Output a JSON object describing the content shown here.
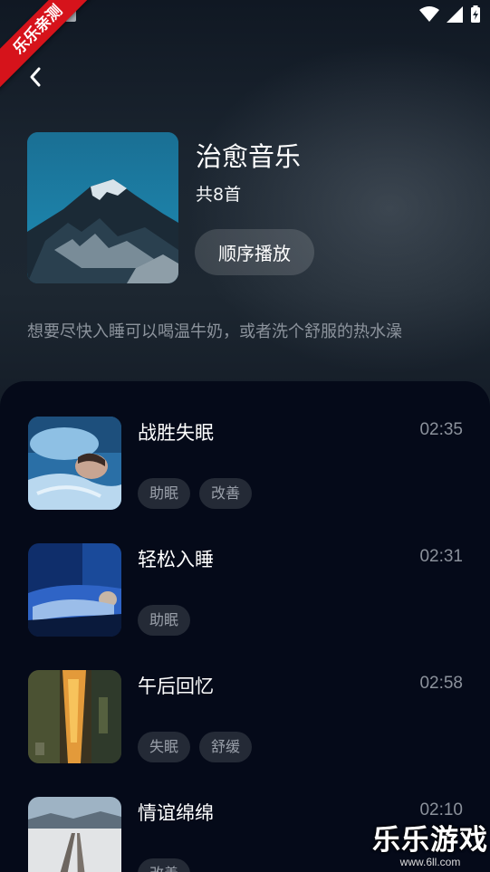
{
  "status_bar": {
    "icons": [
      "wifi-icon",
      "signal-icon",
      "battery-icon"
    ]
  },
  "ribbon": {
    "text": "乐乐亲测"
  },
  "album": {
    "title": "治愈音乐",
    "count": "共8首",
    "play_label": "顺序播放",
    "description": "想要尽快入睡可以喝温牛奶，或者洗个舒服的热水澡"
  },
  "songs": [
    {
      "title": "战胜失眠",
      "duration": "02:35",
      "tags": [
        "助眠",
        "改善"
      ]
    },
    {
      "title": "轻松入睡",
      "duration": "02:31",
      "tags": [
        "助眠"
      ]
    },
    {
      "title": "午后回忆",
      "duration": "02:58",
      "tags": [
        "失眠",
        "舒缓"
      ]
    },
    {
      "title": "情谊绵绵",
      "duration": "02:10",
      "tags": [
        "改善"
      ]
    }
  ],
  "watermark": {
    "brand": "乐乐游戏",
    "url": "www.6ll.com"
  },
  "colors": {
    "ribbon": "#d6131b",
    "panel": "#050a19",
    "tag_bg": "#242a36"
  }
}
